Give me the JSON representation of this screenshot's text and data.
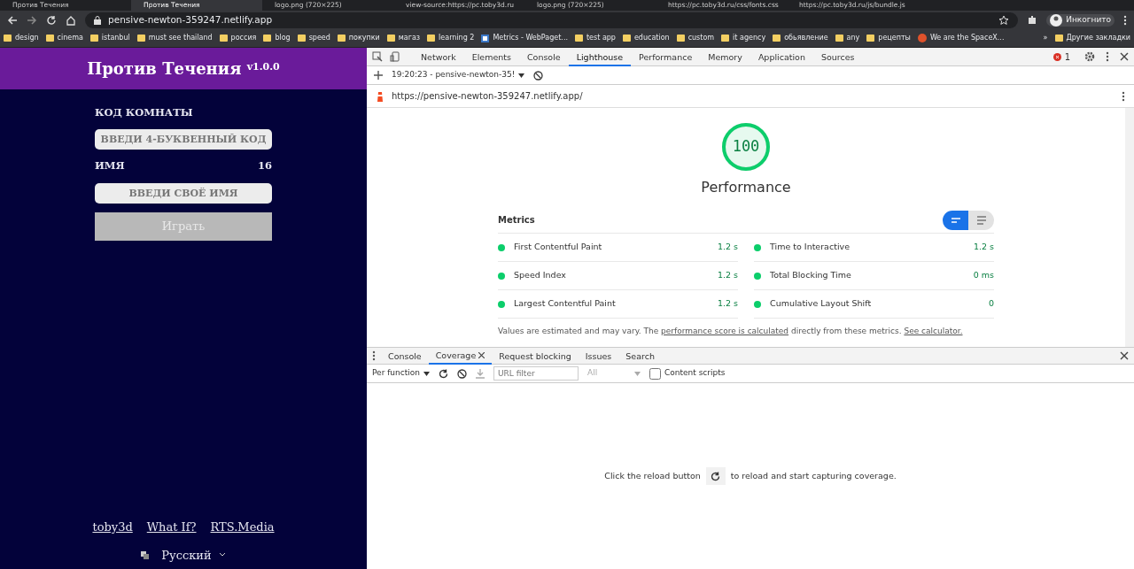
{
  "browser": {
    "tabs": [
      {
        "title": "Против Течения",
        "selected": false
      },
      {
        "title": "Против Течения",
        "selected": true
      },
      {
        "title": "logo.png (720×225)",
        "selected": false
      },
      {
        "title": "view-source:https://pc.toby3d.ru",
        "selected": false
      },
      {
        "title": "logo.png (720×225)",
        "selected": false
      },
      {
        "title": "https://pc.toby3d.ru/css/fonts.css",
        "selected": false
      },
      {
        "title": "https://pc.toby3d.ru/js/bundle.js",
        "selected": false
      }
    ],
    "address": "pensive-newton-359247.netlify.app",
    "profile": "Инкогнито",
    "bookmarks": [
      {
        "label": "design",
        "kind": "folder"
      },
      {
        "label": "cinema",
        "kind": "folder"
      },
      {
        "label": "istanbul",
        "kind": "folder"
      },
      {
        "label": "must see thailand",
        "kind": "folder"
      },
      {
        "label": "россия",
        "kind": "folder"
      },
      {
        "label": "blog",
        "kind": "folder"
      },
      {
        "label": "speed",
        "kind": "folder"
      },
      {
        "label": "покупки",
        "kind": "folder"
      },
      {
        "label": "магаз",
        "kind": "folder"
      },
      {
        "label": "learning 2",
        "kind": "folder"
      },
      {
        "label": "Metrics - WebPaget...",
        "kind": "page"
      },
      {
        "label": "test app",
        "kind": "folder"
      },
      {
        "label": "education",
        "kind": "folder"
      },
      {
        "label": "custom",
        "kind": "folder"
      },
      {
        "label": "it agency",
        "kind": "folder"
      },
      {
        "label": "обьявление",
        "kind": "folder"
      },
      {
        "label": "any",
        "kind": "folder"
      },
      {
        "label": "рецепты",
        "kind": "folder"
      },
      {
        "label": "We are the SpaceX...",
        "kind": "site"
      }
    ],
    "more": "»",
    "other_bookmarks": "Другие закладки"
  },
  "app": {
    "title": "Против Течения",
    "version": "v1.0.0",
    "room_label": "КОД КОМНАТЫ",
    "room_placeholder": "ВВЕДИ 4-БУКВЕННЫЙ КОД",
    "name_label": "ИМЯ",
    "name_counter": "16",
    "name_placeholder": "ВВЕДИ СВОЁ ИМЯ",
    "play_button": "Играть",
    "play_disabled": true,
    "links": [
      "toby3d",
      "What If?",
      "RTS.Media"
    ],
    "language": "Русский"
  },
  "devtools": {
    "tabs": [
      {
        "label": "Network",
        "selected": false
      },
      {
        "label": "Elements",
        "selected": false
      },
      {
        "label": "Console",
        "selected": false
      },
      {
        "label": "Lighthouse",
        "selected": true
      },
      {
        "label": "Performance",
        "selected": false
      },
      {
        "label": "Memory",
        "selected": false
      },
      {
        "label": "Application",
        "selected": false
      },
      {
        "label": "Sources",
        "selected": false
      }
    ],
    "error_count": "1",
    "report_select": "19:20:23 - pensive-newton-35!",
    "report_url": "https://pensive-newton-359247.netlify.app/",
    "score": "100",
    "category": "Performance",
    "metrics_title": "Metrics",
    "metrics": [
      {
        "name": "First Contentful Paint",
        "value": "1.2 s",
        "color": "#0cce6b"
      },
      {
        "name": "Time to Interactive",
        "value": "1.2 s",
        "color": "#0cce6b"
      },
      {
        "name": "Speed Index",
        "value": "1.2 s",
        "color": "#0cce6b"
      },
      {
        "name": "Total Blocking Time",
        "value": "0 ms",
        "color": "#0cce6b"
      },
      {
        "name": "Largest Contentful Paint",
        "value": "1.2 s",
        "color": "#0cce6b"
      },
      {
        "name": "Cumulative Layout Shift",
        "value": "0",
        "color": "#0cce6b"
      }
    ],
    "note": "Values are estimated and may vary. The",
    "note_link": "performance score is calculated",
    "note_after": "directly from these metrics.",
    "calculator_link": "See calculator.",
    "drawer_tabs": [
      {
        "label": "Console",
        "selected": false,
        "closable": false
      },
      {
        "label": "Coverage",
        "selected": true,
        "closable": true
      },
      {
        "label": "Request blocking",
        "selected": false,
        "closable": false
      },
      {
        "label": "Issues",
        "selected": false,
        "closable": false
      },
      {
        "label": "Search",
        "selected": false,
        "closable": false
      }
    ],
    "coverage_mode": "Per function",
    "url_filter_placeholder": "URL filter",
    "type_select": "All",
    "content_scripts": {
      "label": "Content scripts",
      "checked": false
    },
    "reload_before": "Click the reload button",
    "reload_after": "to reload and start capturing coverage."
  }
}
